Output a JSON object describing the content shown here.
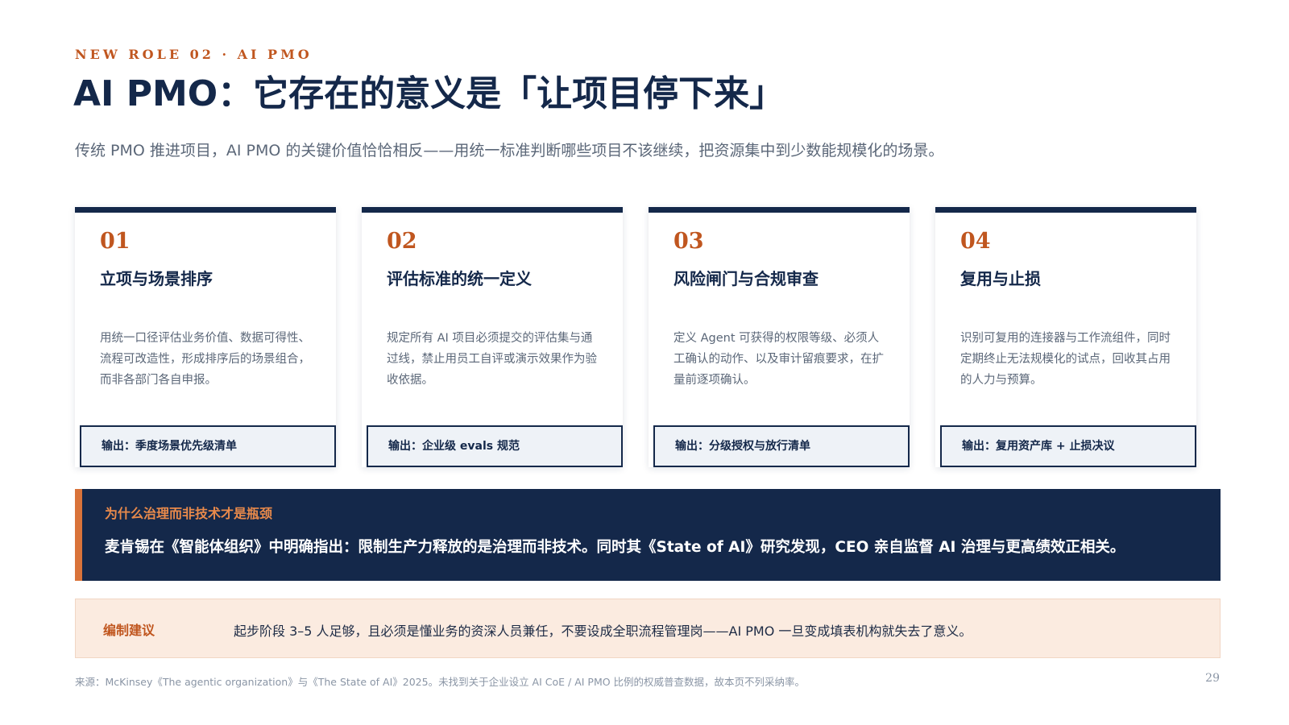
{
  "header": {
    "eyebrow": "NEW ROLE 02 · AI PMO",
    "title": "AI PMO：它存在的意义是「让项目停下来」",
    "subtitle": "传统 PMO 推进项目，AI PMO 的关键价值恰恰相反——用统一标准判断哪些项目不该继续，把资源集中到少数能规模化的场景。"
  },
  "cards": [
    {
      "num": "01",
      "title": "立项与场景排序",
      "body": "用统一口径评估业务价值、数据可得性、流程可改造性，形成排序后的场景组合，而非各部门各自申报。",
      "output": "输出：季度场景优先级清单"
    },
    {
      "num": "02",
      "title": "评估标准的统一定义",
      "body": "规定所有 AI 项目必须提交的评估集与通过线，禁止用员工自评或演示效果作为验收依据。",
      "output": "输出：企业级 evals 规范"
    },
    {
      "num": "03",
      "title": "风险闸门与合规审查",
      "body": "定义 Agent 可获得的权限等级、必须人工确认的动作、以及审计留痕要求，在扩量前逐项确认。",
      "output": "输出：分级授权与放行清单"
    },
    {
      "num": "04",
      "title": "复用与止损",
      "body": "识别可复用的连接器与工作流组件，同时定期终止无法规模化的试点，回收其占用的人力与预算。",
      "output": "输出：复用资产库 + 止损决议"
    }
  ],
  "insight": {
    "label": "为什么治理而非技术才是瓶颈",
    "text": "麦肯锡在《智能体组织》中明确指出：限制生产力释放的是治理而非技术。同时其《State of AI》研究发现，CEO 亲自监督 AI 治理与更高绩效正相关。"
  },
  "advice": {
    "label": "编制建议",
    "text": "起步阶段 3–5 人足够，且必须是懂业务的资深人员兼任，不要设成全职流程管理岗——AI PMO 一旦变成填表机构就失去了意义。"
  },
  "footer": {
    "source": "来源：McKinsey《The agentic organization》与《The State of AI》2025。未找到关于企业设立 AI CoE / AI PMO 比例的权威普查数据，故本页不列采纳率。",
    "page": "29"
  },
  "colors": {
    "navy": "#14284a",
    "accent": "#c0561f",
    "accent_light": "#e98a4b",
    "advice_bg": "#fbebe0"
  }
}
